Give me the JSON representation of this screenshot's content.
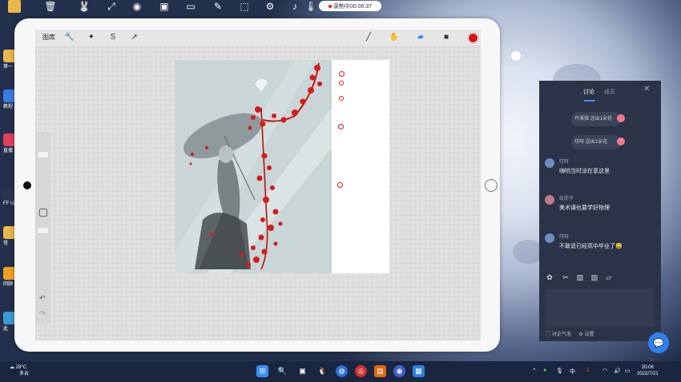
{
  "recorder": {
    "label": "录制中00:06:37"
  },
  "desktop_icons": [
    {
      "label": ""
    },
    {
      "label": "第一"
    },
    {
      "label": "教程"
    },
    {
      "label": "直播"
    },
    {
      "label": "FF Upl"
    },
    {
      "label": "常"
    },
    {
      "label": "回顾"
    },
    {
      "label": "此"
    }
  ],
  "procreate": {
    "gallery_label": "图库",
    "tools": [
      "wrench-icon",
      "magic-wand-icon",
      "selection-icon",
      "transform-arrow-icon"
    ],
    "right_tools": [
      "brush-icon",
      "smudge-icon",
      "eraser-icon",
      "layers-icon"
    ],
    "color": "#d91414"
  },
  "chat": {
    "tabs": {
      "active": "讨论",
      "other": "成员"
    },
    "system_messages": [
      {
        "text": "丹溪猫 送出1朵花"
      },
      {
        "text": "哎呀 送出1朵花"
      }
    ],
    "messages": [
      {
        "user": "哎呀",
        "text": "嗨哟当时没在意这里",
        "avatar_color": "#6b8fc4"
      },
      {
        "user": "凯愿子",
        "text": "美术课也要学好物理",
        "avatar_color": "#c07a8a"
      },
      {
        "user": "哎呀",
        "text": "不敢说已经高中毕业了😅",
        "avatar_color": "#6b8fc4"
      }
    ],
    "footer": {
      "atmosphere": "讨论气泡",
      "settings": "设置"
    }
  },
  "taskbar": {
    "weather": {
      "temp": "28°C",
      "desc": "多云"
    },
    "ime": "中",
    "time": "20:06",
    "date": "2022/7/21"
  }
}
